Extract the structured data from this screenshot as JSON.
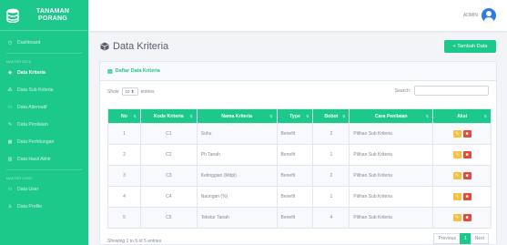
{
  "brand": {
    "line1": "TANAMAN",
    "line2": "PORANG"
  },
  "sidebar": {
    "dashboard": "Dashboard",
    "heading_master": "MASTER DATA",
    "items": [
      {
        "label": "Data Kriteria",
        "icon": "cube-icon"
      },
      {
        "label": "Data Sub Kriteria",
        "icon": "cubes-icon"
      },
      {
        "label": "Data Alternatif",
        "icon": "users-icon"
      },
      {
        "label": "Data Penilaian",
        "icon": "edit-icon"
      },
      {
        "label": "Data Perhitungan",
        "icon": "calculator-icon"
      },
      {
        "label": "Data Hasil Akhir",
        "icon": "chart-icon"
      }
    ],
    "heading_user": "MASTER USER",
    "user_items": [
      {
        "label": "Data User",
        "icon": "users-icon"
      },
      {
        "label": "Data Profile",
        "icon": "user-icon"
      }
    ]
  },
  "topbar": {
    "user": "ADMIN"
  },
  "page": {
    "title": "Data Kriteria",
    "add_button": "+ Tambah Data"
  },
  "card": {
    "title": "Daftar Data Kriteria"
  },
  "controls": {
    "show_label": "Show",
    "show_value": "10",
    "entries_label": "entries",
    "search_label": "Search:"
  },
  "table": {
    "headers": [
      "No",
      "Kode Kriteria",
      "Nama Kriteria",
      "Type",
      "Bobot",
      "Cara Penilaian",
      "Aksi"
    ],
    "rows": [
      {
        "no": "1",
        "kode": "C1",
        "nama": "Suhu",
        "type": "Benefit",
        "bobot": "2",
        "cara": "Pilihan Sub Kriteria"
      },
      {
        "no": "2",
        "kode": "C2",
        "nama": "Ph Tanah",
        "type": "Benefit",
        "bobot": "1",
        "cara": "Pilihan Sub Kriteria"
      },
      {
        "no": "3",
        "kode": "C3",
        "nama": "Ketinggian (Mdpl)",
        "type": "Benefit",
        "bobot": "2",
        "cara": "Pilihan Sub Kriteria"
      },
      {
        "no": "4",
        "kode": "C4",
        "nama": "Naungan (%)",
        "type": "Benefit",
        "bobot": "1",
        "cara": "Pilihan Sub Kriteria"
      },
      {
        "no": "5",
        "kode": "C5",
        "nama": "Tekstur Tanah",
        "type": "Benefit",
        "bobot": "4",
        "cara": "Pilihan Sub Kriteria"
      }
    ]
  },
  "footer": {
    "info": "Showing 1 to 5 of 5 entries",
    "previous": "Previous",
    "page": "1",
    "next": "Next"
  },
  "colors": {
    "accent": "#1cc88a",
    "edit": "#f6c23e",
    "delete": "#e74a3b",
    "avatar": "#2d7be5"
  }
}
